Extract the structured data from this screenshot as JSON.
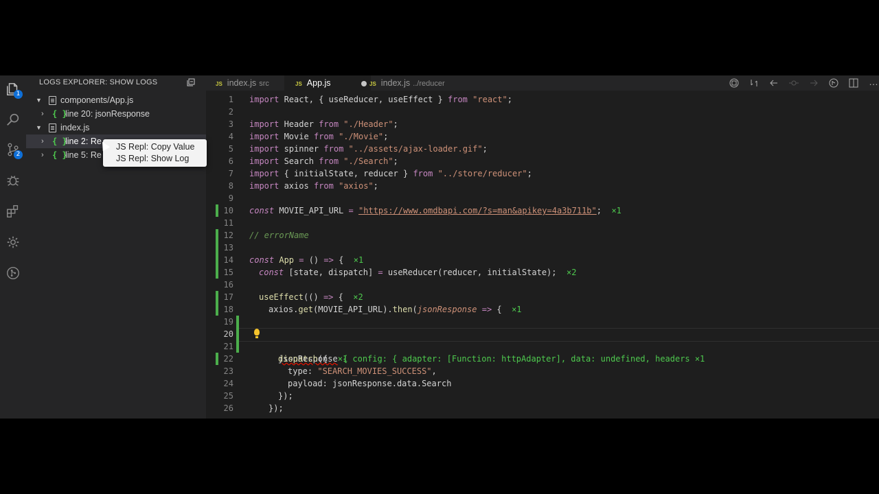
{
  "sidebar": {
    "title": "LOGS EXPLORER: SHOW LOGS",
    "tree": [
      {
        "label": "components/App.js",
        "type": "file"
      },
      {
        "label": "line 20: jsonResponse",
        "type": "log"
      },
      {
        "label": "index.js",
        "type": "file"
      },
      {
        "label": "line 2: Re",
        "type": "log"
      },
      {
        "label": "line 5: Re",
        "type": "log"
      }
    ],
    "context_menu": [
      "JS Repl: Copy Value",
      "JS Repl: Show Log"
    ]
  },
  "activity": {
    "badges": [
      "1",
      "2"
    ]
  },
  "tabs": [
    {
      "label": "index.js",
      "sub": "src"
    },
    {
      "label": "App.js",
      "sub": ""
    },
    {
      "label": "index.js",
      "sub": "../reducer"
    }
  ],
  "code": {
    "numbers": [
      "1",
      "2",
      "3",
      "4",
      "5",
      "6",
      "7",
      "8",
      "9",
      "10",
      "11",
      "12",
      "13",
      "14",
      "15",
      "16",
      "17",
      "18",
      "19",
      "20",
      "21",
      "22",
      "23",
      "24",
      "25",
      "26"
    ],
    "l1": [
      "import",
      " React, { useReducer, useEffect } ",
      "from",
      " ",
      "\"react\"",
      ";"
    ],
    "l3": [
      "import",
      " Header ",
      "from",
      " ",
      "\"./Header\"",
      ";"
    ],
    "l4": [
      "import",
      " Movie ",
      "from",
      " ",
      "\"./Movie\"",
      ";"
    ],
    "l5": [
      "import",
      " spinner ",
      "from",
      " ",
      "\"../assets/ajax-loader.gif\"",
      ";"
    ],
    "l6": [
      "import",
      " Search ",
      "from",
      " ",
      "\"./Search\"",
      ";"
    ],
    "l7": [
      "import",
      " { initialState, reducer } ",
      "from",
      " ",
      "\"../store/reducer\"",
      ";"
    ],
    "l8": [
      "import",
      " axios ",
      "from",
      " ",
      "\"axios\"",
      ";"
    ],
    "l10": [
      "const",
      " MOVIE_API_URL ",
      "=",
      " ",
      "\"https://www.omdbapi.com/?s=man&apikey=4a3b711b\"",
      ";",
      "×1"
    ],
    "l12": "// errorName",
    "l14": [
      "const",
      " App ",
      "=",
      " () ",
      "=>",
      " {",
      "×1"
    ],
    "l15": [
      "const",
      " [state, dispatch] ",
      "=",
      " useReducer(reducer, initialState);",
      "×2"
    ],
    "l17": [
      "useEffect",
      "(() ",
      "=>",
      " {",
      "×2"
    ],
    "l18": [
      "axios.",
      "get",
      "(MOVIE_API_URL).",
      "then",
      "(",
      "jsonResponse",
      " ",
      "=>",
      " {",
      "×1"
    ],
    "l20": [
      "jsonResponse",
      "{ config: { adapter: [Function: httpAdapter], data: undefined, headers",
      "×1"
    ],
    "l22": [
      "dispatch",
      "({",
      "×1"
    ],
    "l23": [
      "type: ",
      "\"SEARCH_MOVIES_SUCCESS\"",
      ","
    ],
    "l24": "payload: jsonResponse.data.Search",
    "l25": "});",
    "l26": "});"
  }
}
